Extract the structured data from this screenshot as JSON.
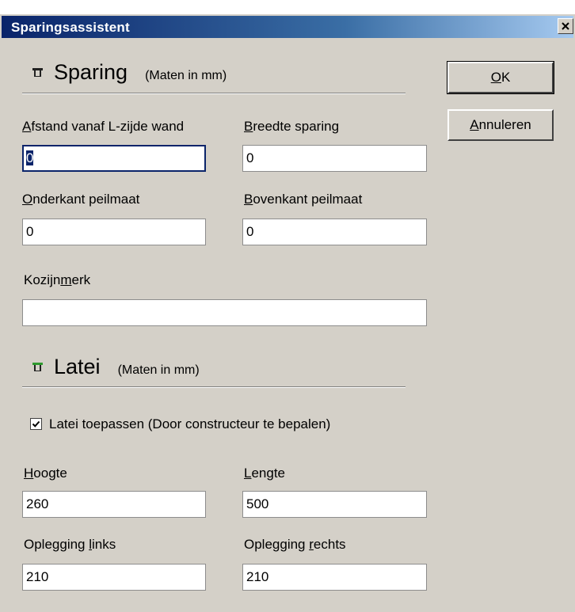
{
  "window": {
    "title": "Sparingsassistent",
    "close_glyph": "×"
  },
  "buttons": {
    "ok": {
      "mnemonic": "O",
      "rest": "K"
    },
    "cancel": {
      "mnemonic": "A",
      "rest": "nnuleren"
    }
  },
  "sparing": {
    "title": "Sparing",
    "units": "(Maten in mm)",
    "icon": "sparing-icon",
    "fields": {
      "afstand": {
        "mnemonic": "A",
        "rest": "fstand vanaf L-zijde wand",
        "value": "0"
      },
      "breedte": {
        "mnemonic": "B",
        "rest": "reedte sparing",
        "value": "0"
      },
      "onderkant": {
        "mnemonic": "O",
        "rest": "nderkant peilmaat",
        "value": "0"
      },
      "bovenkant": {
        "mnemonic": "B",
        "rest": "ovenkant peilmaat",
        "value": "0"
      },
      "kozijnmerk": {
        "pre": "Kozijn",
        "mnemonic": "m",
        "rest": "erk",
        "value": ""
      }
    }
  },
  "latei": {
    "title": "Latei",
    "units": "(Maten in mm)",
    "icon": "latei-icon",
    "icon_color": "#2e9a2e",
    "checkbox": {
      "label": "Latei toepassen (Door constructeur te bepalen)",
      "checked": true
    },
    "fields": {
      "hoogte": {
        "mnemonic": "H",
        "rest": "oogte",
        "value": "260"
      },
      "lengte": {
        "mnemonic": "L",
        "rest": "engte",
        "value": "500"
      },
      "oplegging_links": {
        "pre": "Oplegging ",
        "mnemonic": "l",
        "rest": "inks",
        "value": "210"
      },
      "oplegging_rechts": {
        "pre": "Oplegging ",
        "mnemonic": "r",
        "rest": "echts",
        "value": "210"
      }
    }
  }
}
